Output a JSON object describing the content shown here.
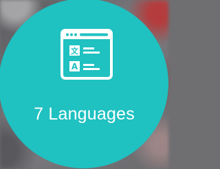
{
  "feature": {
    "label": "7 Languages",
    "icon": "translate-window-icon",
    "icon_glyph_top": "文",
    "icon_glyph_bottom": "A",
    "circle_color": "#1fc1c1",
    "text_color": "#ffffff"
  }
}
